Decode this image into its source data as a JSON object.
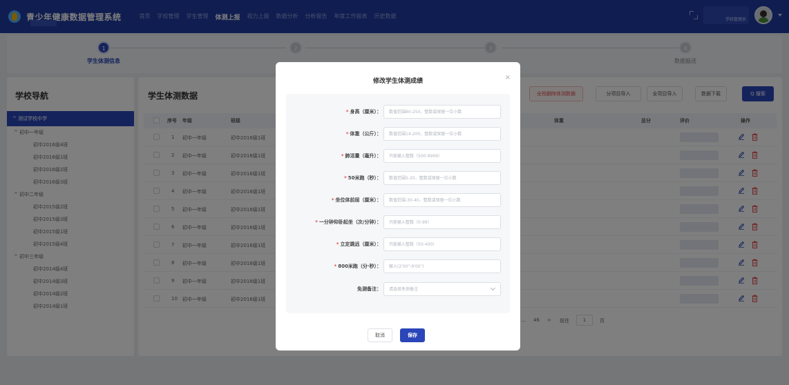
{
  "app": {
    "title": "青少年健康数据管理系统"
  },
  "nav": {
    "items": [
      "首页",
      "学校管理",
      "学生管理",
      "体测上报",
      "视力上报",
      "数据分析",
      "分析报告",
      "年度工作报表",
      "历史数据"
    ],
    "active_index": 3
  },
  "user": {
    "role": "学校管理员"
  },
  "steps": [
    {
      "num": "1",
      "label": "学生体测信息",
      "active": true
    },
    {
      "num": "2",
      "label": "",
      "active": false
    },
    {
      "num": "3",
      "label": "",
      "active": false
    },
    {
      "num": "4",
      "label": "数据报送",
      "active": false
    }
  ],
  "sidebar": {
    "title": "学校导航",
    "root": "测试学校中学",
    "groups": [
      {
        "label": "初中一年级",
        "classes": [
          "初中2016级4班",
          "初中2016级1班",
          "初中2016级2班",
          "初中2016级3班"
        ]
      },
      {
        "label": "初中二年级",
        "classes": [
          "初中2015级2班",
          "初中2015级3班",
          "初中2015级1班",
          "初中2015级4班"
        ]
      },
      {
        "label": "初中三年级",
        "classes": [
          "初中2014级4班",
          "初中2014级3班",
          "初中2014级2班",
          "初中2014级1班"
        ]
      }
    ]
  },
  "main": {
    "title": "学生体测数据",
    "toolbar": {
      "delete_all": "全校删除体测数据",
      "import_item": "分项目导入",
      "import_all": "全项目导入",
      "download": "数据下载",
      "search": "Q 搜索"
    },
    "columns": {
      "index": "序号",
      "grade": "年级",
      "class": "班级",
      "weight": "体重",
      "total": "总分",
      "rating": "评价",
      "actions": "操作"
    },
    "rows": [
      {
        "index": "1",
        "grade": "初中一年级",
        "class": "初中2016级1班"
      },
      {
        "index": "2",
        "grade": "初中一年级",
        "class": "初中2016级1班"
      },
      {
        "index": "3",
        "grade": "初中一年级",
        "class": "初中2016级1班"
      },
      {
        "index": "4",
        "grade": "初中一年级",
        "class": "初中2016级1班"
      },
      {
        "index": "5",
        "grade": "初中一年级",
        "class": "初中2016级1班"
      },
      {
        "index": "6",
        "grade": "初中一年级",
        "class": "初中2016级1班"
      },
      {
        "index": "7",
        "grade": "初中一年级",
        "class": "初中2016级1班"
      },
      {
        "index": "8",
        "grade": "初中一年级",
        "class": "初中2016级1班"
      },
      {
        "index": "9",
        "grade": "初中一年级",
        "class": "初中2016级1班"
      },
      {
        "index": "10",
        "grade": "初中一年级",
        "class": "初中2016级1班"
      }
    ],
    "pager": {
      "ellipsis": "...",
      "last_page": "46",
      "next": ">",
      "goto_label": "前往",
      "goto_value": "1",
      "page_suffix": "页"
    }
  },
  "modal": {
    "title": "修改学生体测成绩",
    "close": "×",
    "fields": [
      {
        "label": "身高（厘米）：",
        "required": true,
        "placeholder": "数值范围80-250，整数或保留一位小数"
      },
      {
        "label": "体重（公斤）：",
        "required": true,
        "placeholder": "数值范围14-200，整数或保留一位小数"
      },
      {
        "label": "肺活量（毫升）：",
        "required": true,
        "placeholder": "只能输入整数（500-9999）"
      },
      {
        "label": "50米跑（秒）：",
        "required": true,
        "placeholder": "数值范围5-20，整数或保留一位小数"
      },
      {
        "label": "坐位体前屈（厘米）：",
        "required": true,
        "placeholder": "数值范围-30-40，整数或保留一位小数"
      },
      {
        "label": "一分钟仰卧起坐（次/分钟）：",
        "required": true,
        "placeholder": "只能输入整数（0-99）"
      },
      {
        "label": "立定跳远（厘米）：",
        "required": true,
        "placeholder": "只能输入整数（50-400）"
      },
      {
        "label": "800米跑（分·秒）：",
        "required": true,
        "placeholder": "输入(2'00\"-9'00\")"
      },
      {
        "label": "免测备注：",
        "required": false,
        "placeholder": "请选择免测备注"
      }
    ],
    "cancel": "取消",
    "save": "保存"
  },
  "colors": {
    "primary": "#2a46b8",
    "topbar": "#203aa0",
    "danger": "#e04c4c"
  }
}
